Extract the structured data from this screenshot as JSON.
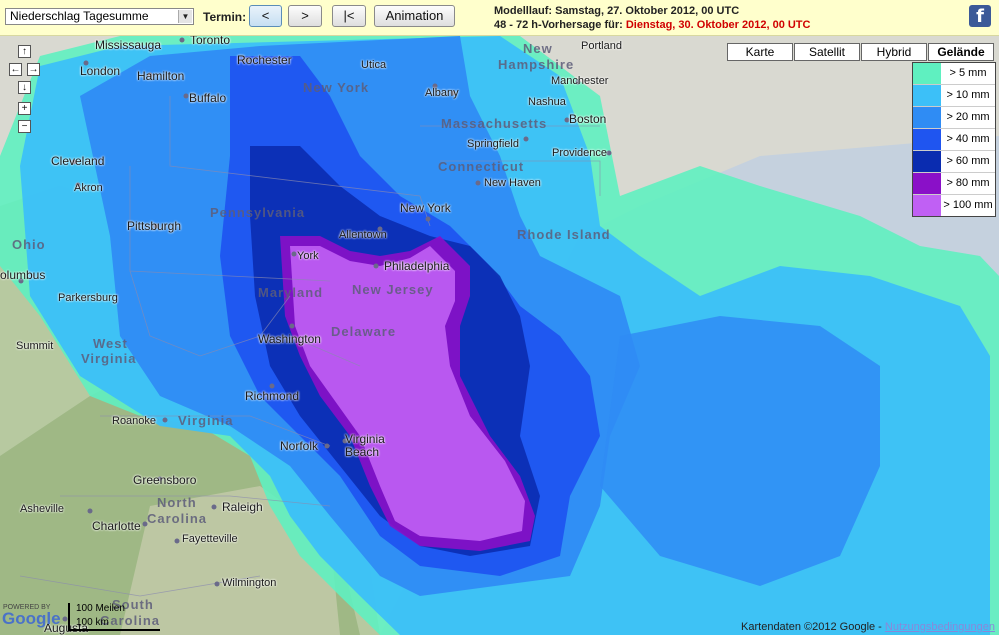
{
  "toolbar": {
    "select_value": "Niederschlag Tagesumme",
    "termin_label": "Termin:",
    "prev_label": "<",
    "next_label": ">",
    "first_label": "|<",
    "animation_label": "Animation",
    "model_run": "Modelllauf: Samstag, 27. Oktober 2012, 00 UTC",
    "forecast_prefix": "48 - 72 h-Vorhersage für: ",
    "forecast_date": "Dienstag, 30. Oktober 2012, 00 UTC",
    "facebook_glyph": "f"
  },
  "map_types": [
    "Karte",
    "Satellit",
    "Hybrid",
    "Gelände"
  ],
  "active_map_type": "Gelände",
  "nav": {
    "up": "↑",
    "left": "←",
    "right": "→",
    "down": "↓",
    "zoom_in": "+",
    "zoom_out": "−"
  },
  "legend": [
    {
      "label": "> 5 mm",
      "color": "#5ff0c0"
    },
    {
      "label": "> 10 mm",
      "color": "#3cc0f8"
    },
    {
      "label": "> 20 mm",
      "color": "#2f8cf4"
    },
    {
      "label": "> 40 mm",
      "color": "#1f55f0"
    },
    {
      "label": "> 60 mm",
      "color": "#0a2cb0"
    },
    {
      "label": "> 80 mm",
      "color": "#8a10c8"
    },
    {
      "label": "> 100 mm",
      "color": "#c060f4"
    }
  ],
  "places": {
    "toronto": "Toronto",
    "mississauga": "Mississauga",
    "london": "London",
    "hamilton": "Hamilton",
    "buffalo": "Buffalo",
    "rochester": "Rochester",
    "utica": "Utica",
    "albany": "Albany",
    "portland": "Portland",
    "manchester": "Manchester",
    "nashua": "Nashua",
    "boston": "Boston",
    "springfield": "Springfield",
    "providence": "Providence",
    "new_haven": "New Haven",
    "new_york": "New York",
    "cleveland": "Cleveland",
    "akron": "Akron",
    "pittsburgh": "Pittsburgh",
    "allentown": "Allentown",
    "philadelphia": "Philadelphia",
    "york": "York",
    "columbus": "olumbus",
    "parkersburg": "Parkersburg",
    "summit": "Summit",
    "washington": "Washington",
    "richmond": "Richmond",
    "roanoke": "Roanoke",
    "norfolk": "Norfolk",
    "virginia_beach_1": "Virginia",
    "virginia_beach_2": "Beach",
    "greensboro": "Greensboro",
    "raleigh": "Raleigh",
    "charlotte": "Charlotte",
    "fayetteville": "Fayetteville",
    "asheville": "Asheville",
    "wilmington": "Wilmington",
    "augusta": "Augusta"
  },
  "states": {
    "new_york": "New York",
    "new_hampshire_1": "New",
    "new_hampshire_2": "Hampshire",
    "massachusetts": "Massachusetts",
    "connecticut": "Connecticut",
    "rhode_island": "Rhode Island",
    "pennsylvania": "Pennsylvania",
    "new_jersey": "New Jersey",
    "maryland": "Maryland",
    "delaware": "Delaware",
    "ohio": "Ohio",
    "west_virginia_1": "West",
    "west_virginia_2": "Virginia",
    "virginia": "Virginia",
    "north_carolina_1": "North",
    "north_carolina_2": "Carolina",
    "south_carolina_1": "South",
    "south_carolina_2": "Carolina"
  },
  "footer": {
    "copyright": "Kartendaten ©2012 Google - ",
    "terms_link": "Nutzungsbedingungen",
    "powered": "POWERED BY",
    "logo": "Google",
    "scale_top": "100 Meilen",
    "scale_bottom": "100 km"
  }
}
